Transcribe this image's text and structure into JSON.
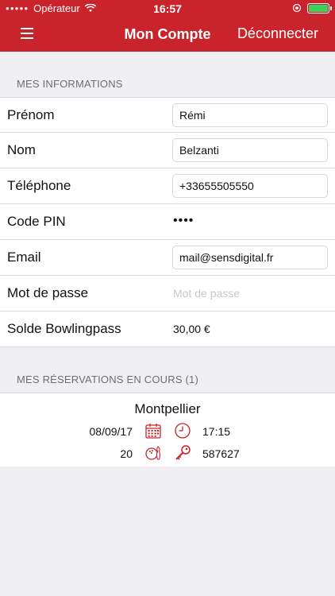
{
  "status_bar": {
    "carrier": "Opérateur",
    "time": "16:57",
    "battery_color": "#3fd05b"
  },
  "nav": {
    "title": "Mon Compte",
    "logout_label": "Déconnecter",
    "menu_icon": "hamburger-menu-icon",
    "bar_color": "#c9242b"
  },
  "info_section": {
    "header": "MES INFORMATIONS",
    "fields": {
      "prenom": {
        "label": "Prénom",
        "value": "Rémi"
      },
      "nom": {
        "label": "Nom",
        "value": "Belzanti"
      },
      "telephone": {
        "label": "Téléphone",
        "value": "+33655505550"
      },
      "pin": {
        "label": "Code PIN",
        "value": "••••"
      },
      "email": {
        "label": "Email",
        "value": "mail@sensdigital.fr"
      },
      "password": {
        "label": "Mot de passe",
        "value": "",
        "placeholder": "Mot de passe"
      },
      "solde": {
        "label": "Solde Bowlingpass",
        "value": "30,00 €"
      }
    }
  },
  "reservations_section": {
    "header": "MES RÉSERVATIONS EN COURS (1)",
    "items": [
      {
        "city": "Montpellier",
        "date": "08/09/17",
        "time": "17:15",
        "players": "20",
        "code": "587627",
        "icons": [
          "calendar-icon",
          "clock-icon",
          "bowling-icon",
          "key-icon"
        ]
      }
    ]
  }
}
